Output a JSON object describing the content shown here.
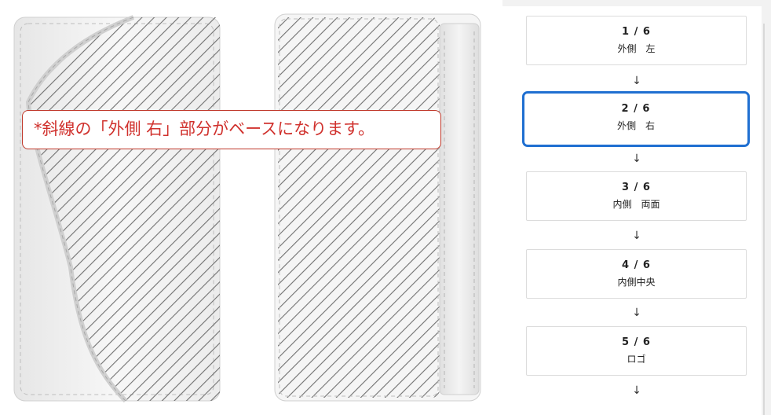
{
  "notice": {
    "text": "*斜線の「外側 右」部分がベースになります。"
  },
  "steps": [
    {
      "number": "1 / 6",
      "label": "外側　左",
      "active": false
    },
    {
      "number": "2 / 6",
      "label": "外側　右",
      "active": true
    },
    {
      "number": "3 / 6",
      "label": "内側　両面",
      "active": false
    },
    {
      "number": "4 / 6",
      "label": "内側中央",
      "active": false
    },
    {
      "number": "5 / 6",
      "label": "ロゴ",
      "active": false
    }
  ],
  "arrow_glyph": "↓",
  "colors": {
    "accent": "#1f6fd1",
    "notice_text": "#d0312d",
    "notice_border": "#c0392b",
    "hatch": "#6a6a6a"
  }
}
